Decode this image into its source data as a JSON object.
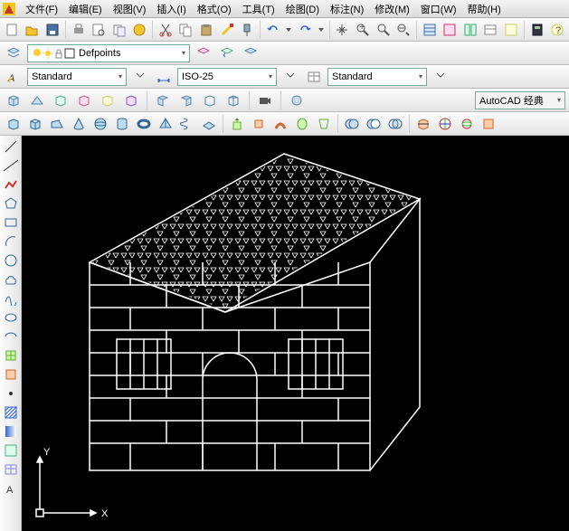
{
  "menu": {
    "items": [
      "文件(F)",
      "编辑(E)",
      "视图(V)",
      "插入(I)",
      "格式(O)",
      "工具(T)",
      "绘图(D)",
      "标注(N)",
      "修改(M)",
      "窗口(W)",
      "帮助(H)"
    ]
  },
  "layer": {
    "current": "Defpoints"
  },
  "styles": {
    "text": "Standard",
    "dim": "ISO-25",
    "table": "Standard"
  },
  "workspace": {
    "current": "AutoCAD 经典"
  },
  "ucs": {
    "x_label": "X",
    "y_label": "Y"
  },
  "icons": {
    "new": "new-icon",
    "open": "open-icon",
    "save": "save-icon",
    "print": "print-icon",
    "preview": "preview-icon",
    "publish": "publish-icon",
    "cut": "cut-icon",
    "copy": "copy-icon",
    "paste": "paste-icon",
    "match": "match-icon",
    "paint": "paint-icon",
    "undo": "undo-icon",
    "redo": "redo-icon",
    "pan": "pan-icon",
    "zoomrt": "zoomrt-icon",
    "zoomwin": "zoomwin-icon",
    "zoomprev": "zoomprev-icon",
    "props": "props-icon",
    "dc": "dc-icon",
    "tp": "tp-icon",
    "ssm": "ssm-icon",
    "markup": "markup-icon",
    "calc": "calc-icon",
    "help": "help-icon",
    "layermgr": "layermgr-icon",
    "layerstate": "layerstate-icon",
    "layeriso": "layeriso-icon",
    "textstyle": "textstyle-icon",
    "dimstyle": "dimstyle-icon",
    "tablestyle": "tablestyle-icon",
    "box": "box-icon",
    "wedge": "wedge-icon",
    "cone": "cone-icon",
    "sphere": "sphere-icon",
    "cylinder": "cylinder-icon",
    "torus": "torus-icon",
    "pyramid": "pyramid-icon",
    "helix": "helix-icon",
    "psolid": "psolid-icon",
    "polysolid": "polysolid-icon",
    "extrude": "extrude-icon",
    "revolve": "revolve-icon",
    "sweep": "sweep-icon",
    "loft": "loft-icon",
    "union": "union-icon",
    "subtract": "subtract-icon",
    "intersect": "intersect-icon",
    "slice": "slice-icon",
    "3dalign": "3dalign-icon",
    "3drotate": "3drotate-icon",
    "camera": "camera-icon",
    "line": "line-icon",
    "xline": "xline-icon",
    "pline": "pline-icon",
    "polygon": "polygon-icon",
    "rect": "rect-icon",
    "arc": "arc-icon",
    "circle": "circle-icon",
    "revcloud": "revcloud-icon",
    "spline": "spline-icon",
    "ellipse": "ellipse-icon",
    "ellipsearc": "ellipsearc-icon",
    "insert": "insert-icon",
    "block": "block-icon",
    "point": "point-icon",
    "hatch": "hatch-icon",
    "gradient": "gradient-icon",
    "region": "region-icon",
    "table": "table-icon",
    "mtext": "mtext-icon"
  }
}
